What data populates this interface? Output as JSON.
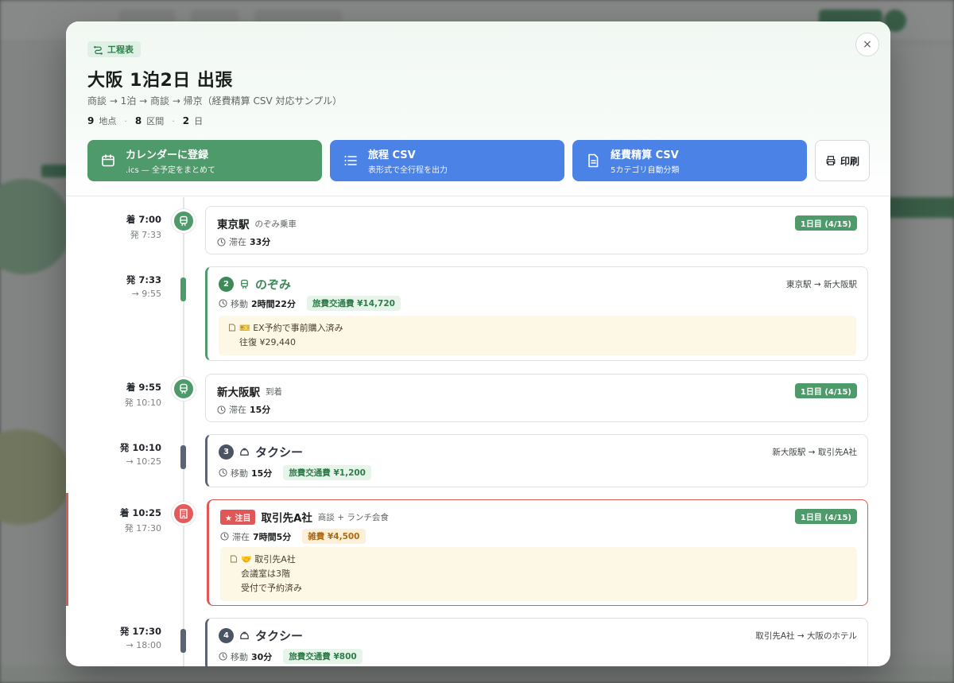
{
  "modal": {
    "tag_label": "工程表",
    "title": "大阪 1泊2日 出張",
    "subtitle": "商談 → 1泊 → 商談 → 帰京（経費精算 CSV 対応サンプル）",
    "stats": [
      {
        "value": "9",
        "unit": "地点"
      },
      {
        "value": "8",
        "unit": "区間"
      },
      {
        "value": "2",
        "unit": "日"
      }
    ],
    "close_label": "×",
    "actions": {
      "calendar": {
        "label": "カレンダーに登録",
        "sub": ".ics — 全予定をまとめて"
      },
      "itinerary_csv": {
        "label": "旅程 CSV",
        "sub": "表形式で全行程を出力"
      },
      "expense_csv": {
        "label": "経費精算 CSV",
        "sub": "5カテゴリ自動分類"
      },
      "print": {
        "label": "印刷"
      }
    }
  },
  "timeline": {
    "stop1": {
      "arrive": "着 7:00",
      "depart": "発 7:33",
      "name": "東京駅",
      "note": "のぞみ乗車",
      "day": "1日目 (4/15)",
      "stay_label": "滞在",
      "stay": "33分",
      "icon": "train-icon"
    },
    "move2": {
      "depart": "発 7:33",
      "arrive": "→ 9:55",
      "num": "2",
      "mode": "のぞみ",
      "route": "東京駅 → 新大阪駅",
      "dur_label": "移動",
      "duration": "2時間22分",
      "fee": "旅費交通費 ¥14,720",
      "memo_line1": "🎫 EX予約で事前購入済み",
      "memo_line2": "往復 ¥29,440"
    },
    "stop2": {
      "arrive": "着 9:55",
      "depart": "発 10:10",
      "name": "新大阪駅",
      "note": "到着",
      "day": "1日目 (4/15)",
      "stay_label": "滞在",
      "stay": "15分"
    },
    "move3": {
      "depart": "発 10:10",
      "arrive": "→ 10:25",
      "num": "3",
      "mode": "タクシー",
      "route": "新大阪駅 → 取引先A社",
      "dur_label": "移動",
      "duration": "15分",
      "fee": "旅費交通費 ¥1,200"
    },
    "stop3": {
      "arrive": "着 10:25",
      "depart": "発 17:30",
      "badge": "★ 注目",
      "name": "取引先A社",
      "note": "商談 + ランチ会食",
      "day": "1日目 (4/15)",
      "stay_label": "滞在",
      "stay": "7時間5分",
      "fee": "雑費 ¥4,500",
      "memo_line1": "🤝 取引先A社",
      "memo_line2": "会議室は3階",
      "memo_line3": "受付で予約済み"
    },
    "move4": {
      "depart": "発 17:30",
      "arrive": "→ 18:00",
      "num": "4",
      "mode": "タクシー",
      "route": "取引先A社 → 大阪のホテル",
      "dur_label": "移動",
      "duration": "30分",
      "fee": "旅費交通費 ¥800"
    }
  },
  "colors": {
    "green": "#4e9a6a",
    "blue": "#4b82e6",
    "red": "#e05757",
    "slate": "#5b6475"
  }
}
